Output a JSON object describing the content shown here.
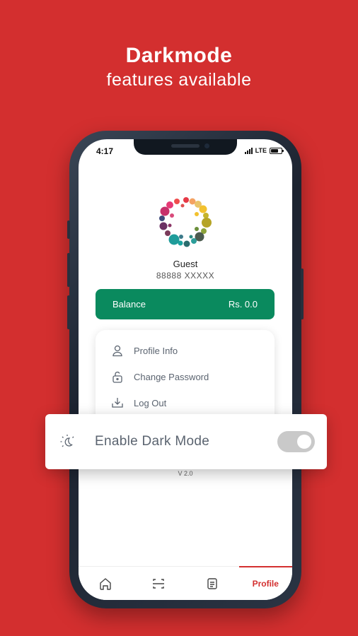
{
  "promo": {
    "title": "Darkmode",
    "subtitle": "features available"
  },
  "status_bar": {
    "time": "4:17",
    "network": "LTE"
  },
  "profile": {
    "name": "Guest",
    "phone": "88888 XXXXX"
  },
  "balance": {
    "label": "Balance",
    "amount": "Rs. 0.0"
  },
  "menu": {
    "items": [
      {
        "label": "Profile Info",
        "icon": "user-icon"
      },
      {
        "label": "Change Password",
        "icon": "unlock-icon"
      },
      {
        "label": "Log Out",
        "icon": "logout-icon"
      }
    ]
  },
  "dark_mode": {
    "label": "Enable Dark Mode",
    "icon": "moon-sun-icon",
    "enabled": false
  },
  "version": "V 2.0",
  "bottom_nav": {
    "items": [
      {
        "name": "home",
        "icon": "home-icon"
      },
      {
        "name": "scan",
        "icon": "scan-icon"
      },
      {
        "name": "orders",
        "icon": "list-icon"
      },
      {
        "name": "profile",
        "label": "Profile",
        "active": true
      }
    ]
  },
  "colors": {
    "background": "#d32f2f",
    "balance_green": "#0a8a5e",
    "accent_red": "#d32f2f"
  }
}
